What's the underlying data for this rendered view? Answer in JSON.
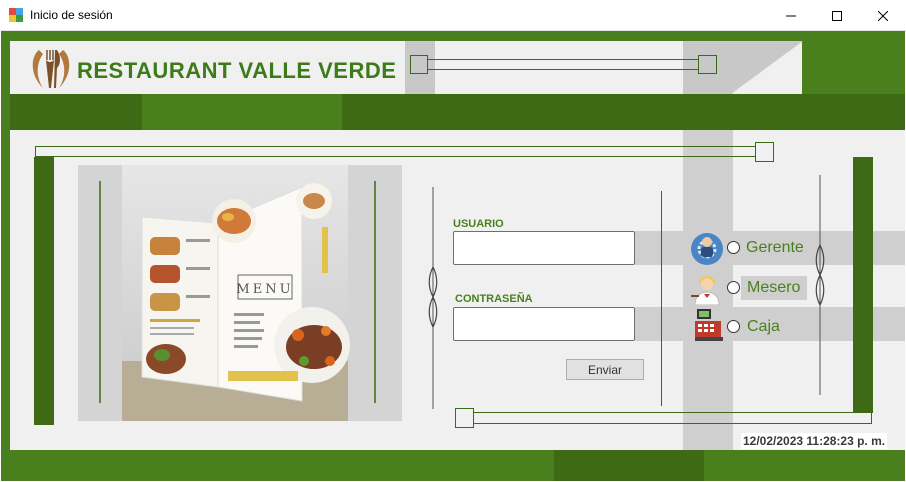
{
  "window": {
    "title": "Inicio de sesión",
    "minimize_glyph": "─",
    "maximize_glyph": "☐",
    "close_glyph": "✕"
  },
  "brand": {
    "title": "RESTAURANT VALLE VERDE"
  },
  "menu_image": {
    "card_label": "MENU"
  },
  "login": {
    "user_label": "USUARIO",
    "user_value": "",
    "password_label": "CONTRASEÑA",
    "password_value": "",
    "submit_label": "Enviar"
  },
  "roles": [
    {
      "label": "Gerente",
      "icon": "manager-icon",
      "selected": false
    },
    {
      "label": "Mesero",
      "icon": "waiter-icon",
      "selected": false
    },
    {
      "label": "Caja",
      "icon": "cash-register-icon",
      "selected": false
    }
  ],
  "status": {
    "datetime": "12/02/2023 11:28:23 p. m."
  },
  "colors": {
    "green_dark": "#3e6a15",
    "green": "#4a7f1e",
    "panel": "#f0f0f0",
    "gray_strip": "#cfcfcf"
  }
}
